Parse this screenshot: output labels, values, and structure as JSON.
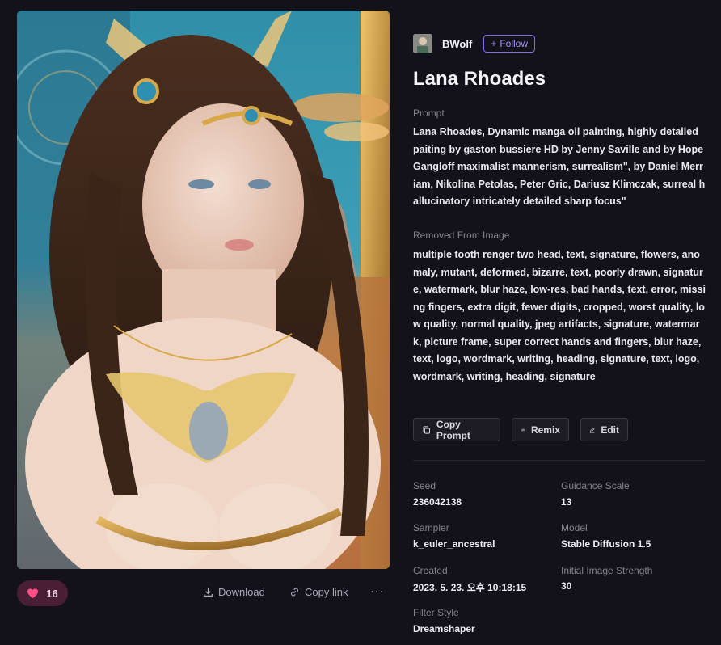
{
  "author": {
    "name": "BWolf",
    "follow_label": "Follow"
  },
  "title": "Lana Rhoades",
  "prompt": {
    "label": "Prompt",
    "text": "Lana Rhoades, Dynamic manga oil painting, highly detailed paiting by gaston bussiere HD by Jenny Saville and by Hope Gangloff maximalist mannerism, surrealism\", by Daniel Merriam, Nikolina Petolas, Peter Gric, Dariusz Klimczak, surreal hallucinatory intricately detailed sharp focus\""
  },
  "removed": {
    "label": "Removed From Image",
    "text": "multiple tooth renger two head, text, signature, flowers, anomaly, mutant, deformed, bizarre, text, poorly drawn, signature, watermark, blur haze, low-res, bad hands, text, error, missing fingers, extra digit, fewer digits, cropped, worst quality, low quality, normal quality, jpeg artifacts, signature, watermark, picture frame, super correct hands and fingers, blur haze, text, logo, wordmark, writing, heading, signature, text, logo, wordmark, writing, heading, signature"
  },
  "actions": {
    "copy_prompt": "Copy Prompt",
    "remix": "Remix",
    "edit": "Edit"
  },
  "meta": {
    "seed_label": "Seed",
    "seed": "236042138",
    "guidance_label": "Guidance Scale",
    "guidance": "13",
    "sampler_label": "Sampler",
    "sampler": "k_euler_ancestral",
    "model_label": "Model",
    "model": "Stable Diffusion 1.5",
    "created_label": "Created",
    "created": "2023. 5. 23. 오후 10:18:15",
    "strength_label": "Initial Image Strength",
    "strength": "30",
    "filter_label": "Filter Style",
    "filter": "Dreamshaper"
  },
  "footer": {
    "likes": "16",
    "download": "Download",
    "copy_link": "Copy link",
    "more": "···"
  },
  "colors": {
    "accent": "#7b6cf0",
    "like_bg": "#4a1f35",
    "heart": "#ff4f86",
    "background": "#13121a"
  },
  "icons": [
    "plus-icon",
    "heart-icon",
    "download-icon",
    "link-icon",
    "more-icon",
    "copy-icon",
    "remix-icon",
    "edit-icon"
  ]
}
